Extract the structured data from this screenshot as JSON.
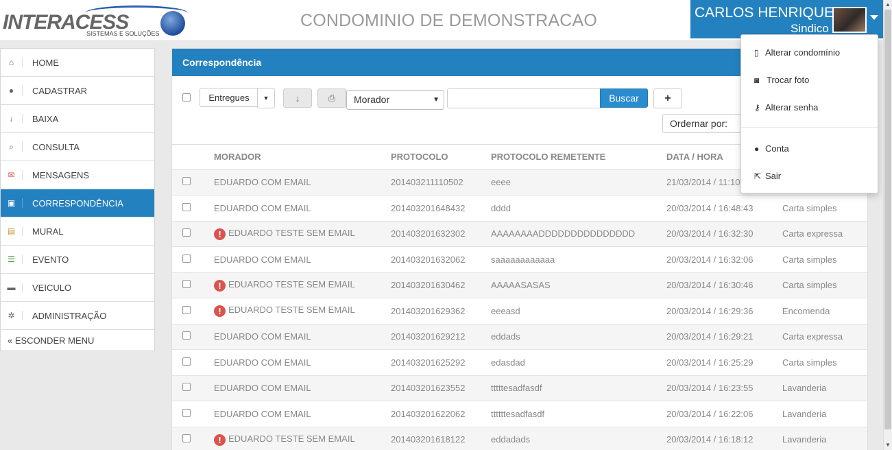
{
  "header": {
    "logo_text": "INTERACESS",
    "logo_sub": "SISTEMAS E SOLUÇÕES",
    "site_title": "CONDOMINIO DE DEMONSTRACAO",
    "user_name": "CARLOS HENRIQUE",
    "user_role": "Sindico"
  },
  "sidebar": {
    "items": [
      {
        "label": "HOME",
        "icon": "home-icon"
      },
      {
        "label": "CADASTRAR",
        "icon": "user-icon"
      },
      {
        "label": "BAIXA",
        "icon": "arrow-down-icon"
      },
      {
        "label": "CONSULTA",
        "icon": "search-icon"
      },
      {
        "label": "MENSAGENS",
        "icon": "envelope-icon"
      },
      {
        "label": "CORRESPONDÊNCIA",
        "icon": "inbox-icon"
      },
      {
        "label": "MURAL",
        "icon": "bulletin-icon"
      },
      {
        "label": "EVENTO",
        "icon": "list-icon"
      },
      {
        "label": "VEICULO",
        "icon": "truck-icon"
      },
      {
        "label": "ADMINISTRAÇÃO",
        "icon": "cog-icon"
      }
    ],
    "hide_label": "« ESCONDER MENU"
  },
  "panel": {
    "title": "Correspondência",
    "filter_label": "Entregues",
    "select_value": "Morador",
    "search_value": "",
    "search_button": "Buscar",
    "add_button": "+",
    "order_label": "Ordernar por:"
  },
  "table": {
    "headers": [
      "MORADOR",
      "PROTOCOLO",
      "PROTOCOLO REMETENTE",
      "DATA / HORA",
      ""
    ],
    "rows": [
      {
        "morador": "EDUARDO COM EMAIL",
        "warn": false,
        "protocolo": "201403211110502",
        "remetente": "eeee",
        "data": "21/03/2014 / 11:10:",
        "tipo": ""
      },
      {
        "morador": "EDUARDO COM EMAIL",
        "warn": false,
        "protocolo": "201403201648432",
        "remetente": "dddd",
        "data": "20/03/2014 / 16:48:43",
        "tipo": "Carta simples"
      },
      {
        "morador": "EDUARDO TESTE SEM EMAIL",
        "warn": true,
        "protocolo": "201403201632302",
        "remetente": "AAAAAAAADDDDDDDDDDDDDDD",
        "data": "20/03/2014 / 16:32:30",
        "tipo": "Carta expressa"
      },
      {
        "morador": "EDUARDO COM EMAIL",
        "warn": false,
        "protocolo": "201403201632062",
        "remetente": "saaaaaaaaaaaa",
        "data": "20/03/2014 / 16:32:06",
        "tipo": "Carta simples"
      },
      {
        "morador": "EDUARDO TESTE SEM EMAIL",
        "warn": true,
        "protocolo": "201403201630462",
        "remetente": "AAAAASASAS",
        "data": "20/03/2014 / 16:30:46",
        "tipo": "Carta simples"
      },
      {
        "morador": "EDUARDO TESTE SEM EMAIL",
        "warn": true,
        "protocolo": "201403201629362",
        "remetente": "eeeasd",
        "data": "20/03/2014 / 16:29:36",
        "tipo": "Encomenda"
      },
      {
        "morador": "EDUARDO COM EMAIL",
        "warn": false,
        "protocolo": "201403201629212",
        "remetente": "eddads",
        "data": "20/03/2014 / 16:29:21",
        "tipo": "Carta expressa"
      },
      {
        "morador": "EDUARDO COM EMAIL",
        "warn": false,
        "protocolo": "201403201625292",
        "remetente": "edasdad",
        "data": "20/03/2014 / 16:25:29",
        "tipo": "Carta simples"
      },
      {
        "morador": "EDUARDO COM EMAIL",
        "warn": false,
        "protocolo": "201403201623552",
        "remetente": "tttttesadfasdf",
        "data": "20/03/2014 / 16:23:55",
        "tipo": "Lavanderia"
      },
      {
        "morador": "EDUARDO COM EMAIL",
        "warn": false,
        "protocolo": "201403201622062",
        "remetente": "ttttttesadfasdf",
        "data": "20/03/2014 / 16:22:06",
        "tipo": "Lavanderia"
      },
      {
        "morador": "EDUARDO TESTE SEM EMAIL",
        "warn": true,
        "protocolo": "201403201618122",
        "remetente": "eddadads",
        "data": "20/03/2014 / 16:18:12",
        "tipo": "Lavanderia"
      }
    ]
  },
  "dropdown": {
    "items": [
      {
        "label": "Alterar condomínio",
        "icon": "building-icon"
      },
      {
        "label": "Trocar foto",
        "icon": "camera-icon"
      },
      {
        "label": "Alterar senha",
        "icon": "key-icon"
      },
      {
        "label": "Conta",
        "icon": "user-icon"
      },
      {
        "label": "Sair",
        "icon": "sign-out-icon"
      }
    ]
  },
  "colors": {
    "primary": "#2481c0",
    "warning": "#d9534f"
  }
}
